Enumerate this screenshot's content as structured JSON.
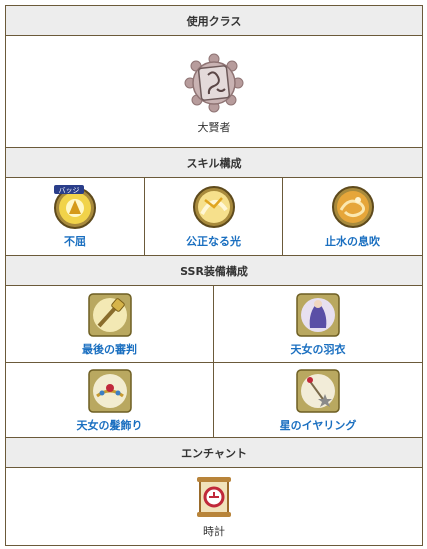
{
  "class_section": {
    "header": "使用クラス",
    "name": "大賢者",
    "icon": "sage-crest-icon"
  },
  "skill_section": {
    "header": "スキル構成",
    "items": [
      {
        "name": "不屈",
        "icon": "unbowed-skill-icon",
        "badge": "バッジ"
      },
      {
        "name": "公正なる光",
        "icon": "just-light-skill-icon"
      },
      {
        "name": "止水の息吹",
        "icon": "still-water-skill-icon"
      }
    ]
  },
  "ssr_section": {
    "header": "SSR装備構成",
    "items": [
      {
        "name": "最後の審判",
        "icon": "last-judgment-icon"
      },
      {
        "name": "天女の羽衣",
        "icon": "celestial-robe-icon"
      },
      {
        "name": "天女の髪飾り",
        "icon": "celestial-hairpin-icon"
      },
      {
        "name": "星のイヤリング",
        "icon": "star-earring-icon"
      }
    ]
  },
  "enchant_section": {
    "header": "エンチャント",
    "name": "時計",
    "icon": "clock-scroll-icon"
  },
  "colors": {
    "border": "#6b5a3a",
    "header_bg": "#ededed",
    "link": "#1a6fc0"
  }
}
